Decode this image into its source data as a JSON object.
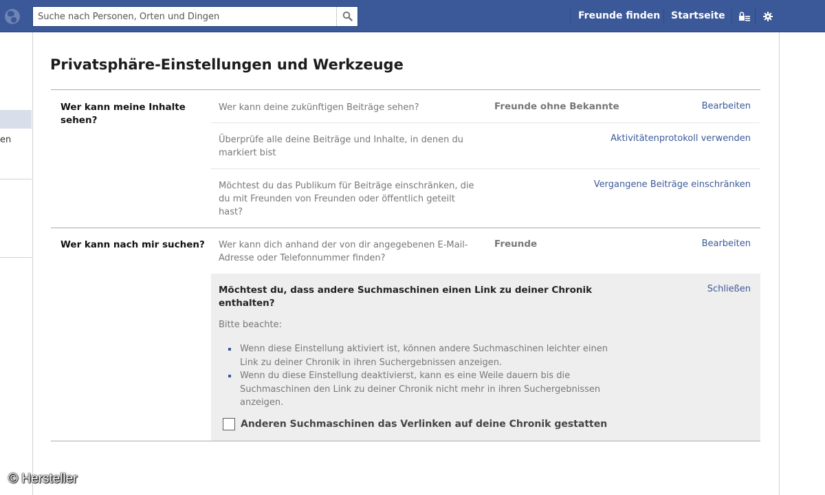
{
  "header": {
    "search_placeholder": "Suche nach Personen, Orten und Dingen",
    "nav": [
      "Freunde finden",
      "Startseite"
    ],
    "brand_color": "#3b5998"
  },
  "sidebar": {
    "partial_text": "en"
  },
  "page": {
    "title": "Privatsphäre-Einstellungen und Werkzeuge"
  },
  "sections": [
    {
      "label": "Wer kann meine Inhalte sehen?",
      "rows": [
        {
          "question": "Wer kann deine zukünftigen Beiträge sehen?",
          "value": "Freunde ohne Bekannte",
          "action": "Bearbeiten"
        },
        {
          "question": "Überprüfe alle deine Beiträge und Inhalte, in denen du markiert bist",
          "value": "",
          "action": "Aktivitätenprotokoll verwenden"
        },
        {
          "question": "Möchtest du das Publikum für Beiträge einschränken, die du mit Freunden von Freunden oder öffentlich geteilt hast?",
          "value": "",
          "action": "Vergangene Beiträge einschränken"
        }
      ]
    },
    {
      "label": "Wer kann nach mir suchen?",
      "rows": [
        {
          "question": "Wer kann dich anhand der von dir angegebenen E-Mail-Adresse oder Telefonnummer finden?",
          "value": "Freunde",
          "action": "Bearbeiten"
        }
      ],
      "panel": {
        "title": "Möchtest du, dass andere Suchmaschinen einen Link zu deiner Chronik enthalten?",
        "close": "Schließen",
        "note": "Bitte beachte:",
        "bullets": [
          "Wenn diese Einstellung aktiviert ist, können andere Suchmaschinen leichter einen Link zu deiner Chronik in ihren Suchergebnissen anzeigen.",
          "Wenn du diese Einstellung deaktivierst, kann es eine Weile dauern bis die Suchmaschinen den Link zu deiner Chronik nicht mehr in ihren Suchergebnissen anzeigen."
        ],
        "checkbox_label": "Anderen Suchmaschinen das Verlinken auf deine Chronik gestatten",
        "checkbox_checked": false
      }
    }
  ],
  "watermark": "© Hersteller"
}
